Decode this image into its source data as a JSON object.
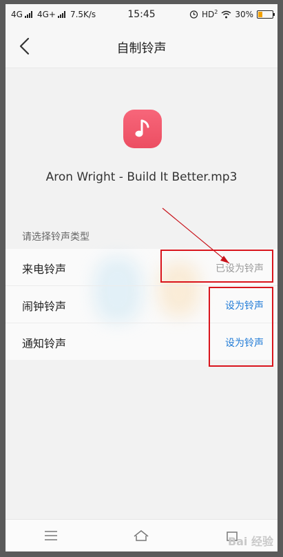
{
  "statusbar": {
    "network1": "4G",
    "network2": "4G+",
    "speed": "7.5K/s",
    "time": "15:45",
    "hd": "HD",
    "hd_sup": "2",
    "battery_percent": "30%",
    "battery_level": 0.3,
    "accent_battery": "#f2a100"
  },
  "header": {
    "title": "自制铃声",
    "back_icon": "chevron-left-icon"
  },
  "file": {
    "icon": "music-note-icon",
    "name": "Aron Wright - Build It Better.mp3",
    "icon_color": "#ef5a6e"
  },
  "ringtone_types": {
    "label": "请选择铃声类型",
    "items": [
      {
        "label": "来电铃声",
        "action": "已设为铃声",
        "enabled": false
      },
      {
        "label": "闹钟铃声",
        "action": "设为铃声",
        "enabled": true
      },
      {
        "label": "通知铃声",
        "action": "设为铃声",
        "enabled": true
      }
    ],
    "action_color": "#1f7ad6"
  },
  "navbar": {
    "items": [
      "menu-icon",
      "home-icon",
      "back-icon"
    ]
  },
  "watermark": "Bai 经验"
}
